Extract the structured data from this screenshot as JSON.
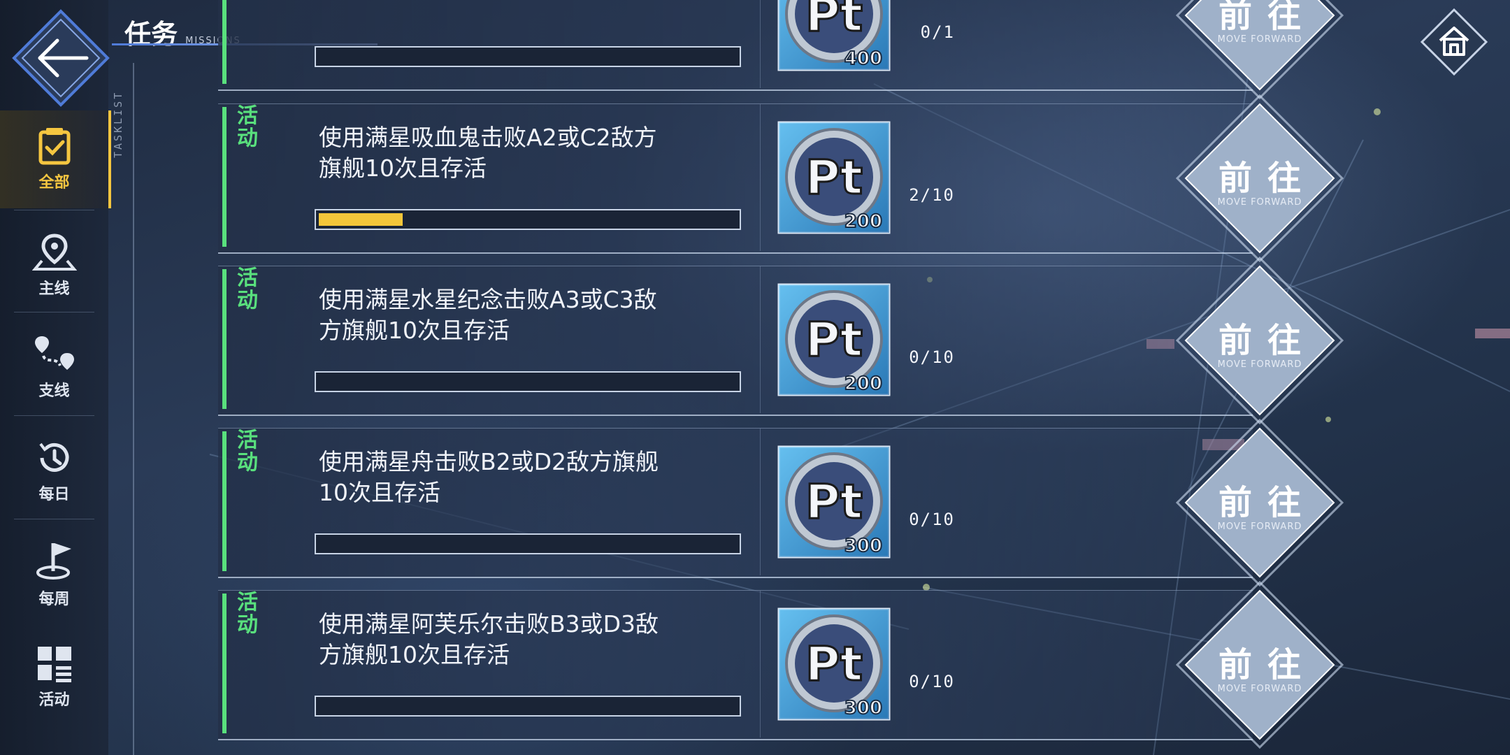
{
  "header": {
    "title": "任务",
    "subtitle": "MISSIONS",
    "tasklist_label": "TASKLIST"
  },
  "nav": {
    "items": [
      {
        "label": "全部",
        "icon": "clipboard-check-icon",
        "active": true
      },
      {
        "label": "主线",
        "icon": "map-pin-icon",
        "active": false
      },
      {
        "label": "支线",
        "icon": "route-icon",
        "active": false
      },
      {
        "label": "每日",
        "icon": "history-clock-icon",
        "active": false
      },
      {
        "label": "每周",
        "icon": "flag-icon",
        "active": false
      },
      {
        "label": "活动",
        "icon": "activity-grid-icon",
        "active": false
      }
    ]
  },
  "go_button": {
    "label": "前往",
    "sublabel": "MOVE FORWARD"
  },
  "tasks": [
    {
      "tag": "",
      "description": "",
      "progress_text": "0/1",
      "progress": 0,
      "reward": "400"
    },
    {
      "tag": "活动",
      "description": "使用满星吸血鬼击败A2或C2敌方旗舰10次且存活",
      "progress_text": "2/10",
      "progress": 0.2,
      "reward": "200"
    },
    {
      "tag": "活动",
      "description": "使用满星水星纪念击败A3或C3敌方旗舰10次且存活",
      "progress_text": "0/10",
      "progress": 0,
      "reward": "200"
    },
    {
      "tag": "活动",
      "description": "使用满星舟击败B2或D2敌方旗舰10次且存活",
      "progress_text": "0/10",
      "progress": 0,
      "reward": "300"
    },
    {
      "tag": "活动",
      "description": "使用满星阿芙乐尔击败B3或D3敌方旗舰10次且存活",
      "progress_text": "0/10",
      "progress": 0,
      "reward": "300"
    }
  ],
  "reward_icon": {
    "icon": "pt-coin-icon",
    "text": "Pt"
  },
  "colors": {
    "accent_green": "#59e07d",
    "active_gold": "#f5c640",
    "progress_fill": "#f3c63a"
  }
}
